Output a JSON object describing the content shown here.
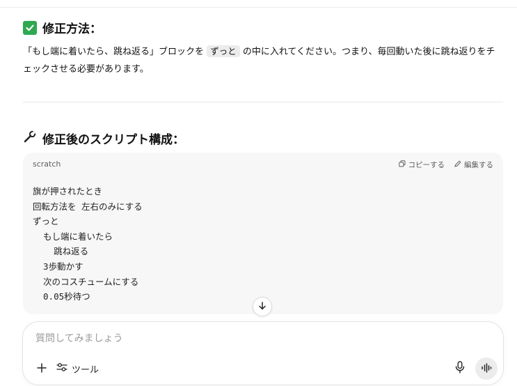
{
  "fix_section": {
    "title": "修正方法：",
    "text_before": "「もし端に着いたら、跳ね返る」ブロックを",
    "inline_code": "ずっと",
    "text_after": "の中に入れてください。つまり、毎回動いた後に跳ね返りをチェックさせる必要があります。"
  },
  "script_section": {
    "title": "修正後のスクリプト構成："
  },
  "code_block": {
    "language": "scratch",
    "copy_label": "コピーする",
    "edit_label": "編集する",
    "lines": [
      "旗が押されたとき",
      "回転方法を 左右のみにする",
      "ずっと",
      "  もし端に着いたら",
      "    跳ね返る",
      "  3歩動かす",
      "  次のコスチュームにする",
      "  0.05秒待つ"
    ]
  },
  "composer": {
    "placeholder": "質問してみましょう",
    "tools_label": "ツール"
  },
  "colors": {
    "check_green": "#2fa84f",
    "code_bg": "#f7f7f7"
  },
  "icons": {
    "check": "check-box-icon",
    "wrench": "wrench-icon",
    "copy": "copy-icon",
    "edit": "pencil-icon",
    "scroll": "arrow-down-icon",
    "plus": "plus-icon",
    "tools": "sliders-icon",
    "mic": "microphone-icon",
    "voice": "voice-wave-icon"
  }
}
